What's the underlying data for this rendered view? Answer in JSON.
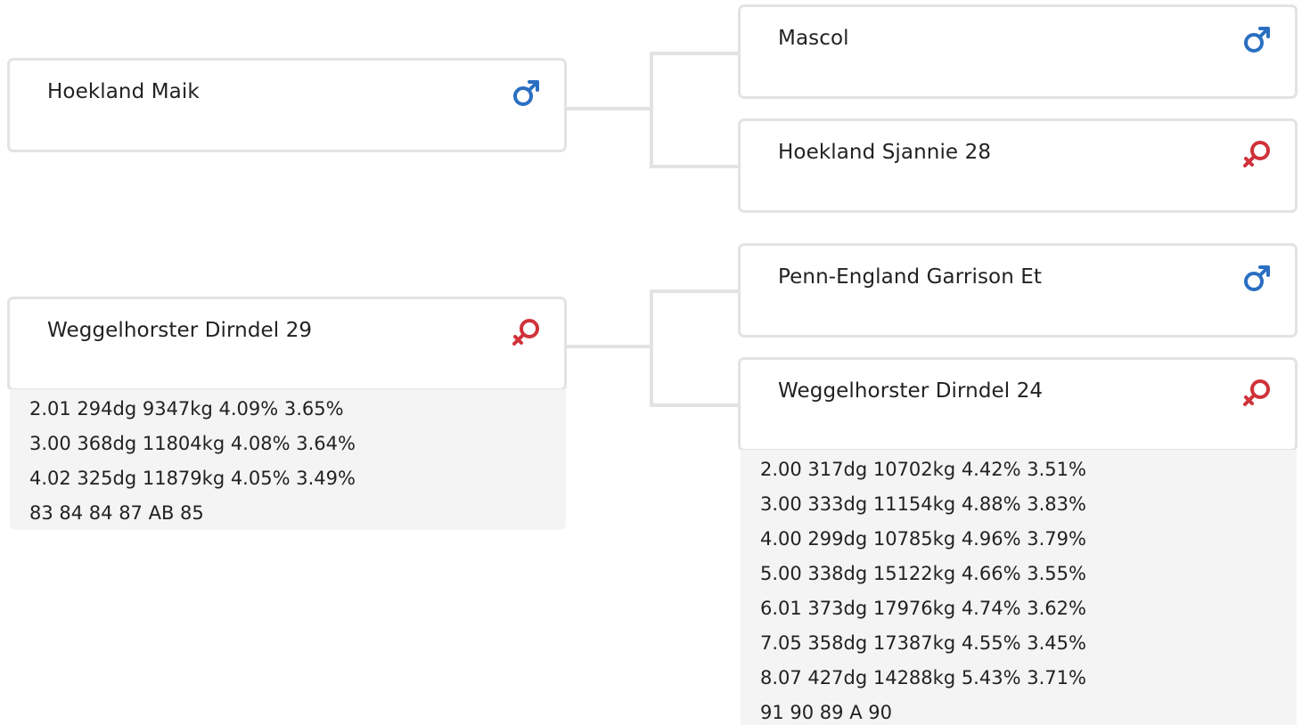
{
  "pedigree": {
    "sire": {
      "name": "Hoekland Maik",
      "sex": "male-icon",
      "sire": {
        "name": "Mascol",
        "sex": "male-icon"
      },
      "dam": {
        "name": "Hoekland Sjannie 28",
        "sex": "female-icon"
      }
    },
    "dam": {
      "name": "Weggelhorster Dirndel 29",
      "sex": "female-icon",
      "stats": [
        "2.01 294dg 9347kg 4.09% 3.65%",
        "3.00 368dg 11804kg 4.08% 3.64%",
        "4.02 325dg 11879kg 4.05% 3.49%",
        "83 84 84 87 AB 85"
      ],
      "sire": {
        "name": "Penn-England Garrison Et",
        "sex": "male-icon"
      },
      "dam": {
        "name": "Weggelhorster Dirndel 24",
        "sex": "female-icon",
        "stats": [
          "2.00 317dg 10702kg 4.42% 3.51%",
          "3.00 333dg 11154kg 4.88% 3.83%",
          "4.00 299dg 10785kg 4.96% 3.79%",
          "5.00 338dg 15122kg 4.66% 3.55%",
          "6.01 373dg 17976kg 4.74% 3.62%",
          "7.05 358dg 17387kg 4.55% 3.45%",
          "8.07 427dg 14288kg 5.43% 3.71%",
          "91 90 89 A 90"
        ]
      }
    }
  },
  "colors": {
    "male": "#2a6fc2",
    "female": "#d0323a",
    "line": "#e3e3e3"
  }
}
